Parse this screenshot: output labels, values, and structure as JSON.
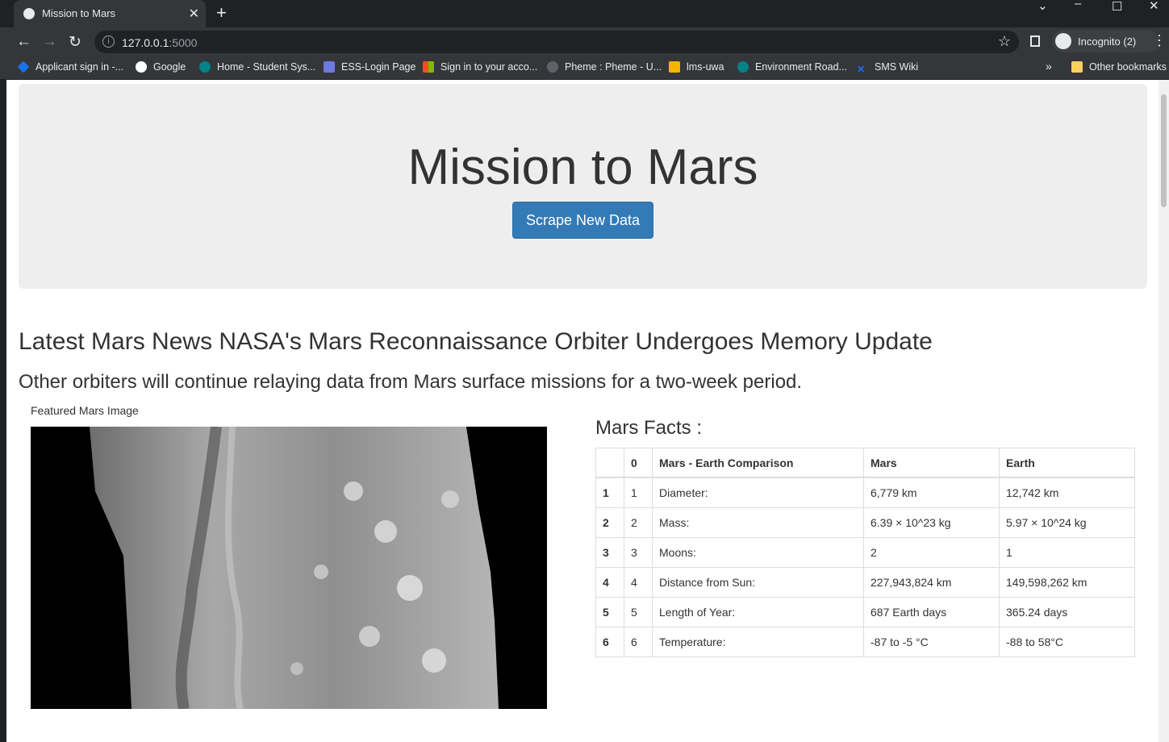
{
  "browser": {
    "tab_title": "Mission to Mars",
    "url_host": "127.0.0.1",
    "url_port": ":5000",
    "incognito_label": "Incognito (2)",
    "bookmarks": [
      {
        "label": "Applicant sign in -...",
        "icon": "diamond-icon",
        "color": "#1a73e8"
      },
      {
        "label": "Google",
        "icon": "google-icon",
        "color": "#ffffff"
      },
      {
        "label": "Home - Student Sys...",
        "icon": "sharepoint-icon",
        "color": "#038387"
      },
      {
        "label": "ESS-Login Page",
        "icon": "crest-icon",
        "color": "#6c7ae0"
      },
      {
        "label": "Sign in to your acco...",
        "icon": "microsoft-icon",
        "color": "#f25022"
      },
      {
        "label": "Pheme : Pheme - U...",
        "icon": "globe-icon",
        "color": "#5f6368"
      },
      {
        "label": "lms-uwa",
        "icon": "pencil-icon",
        "color": "#f4b400"
      },
      {
        "label": "Environment Road...",
        "icon": "sharepoint-icon",
        "color": "#038387"
      },
      {
        "label": "SMS Wiki",
        "icon": "x-icon",
        "color": "#1a73e8"
      }
    ],
    "other_bookmarks": "Other bookmarks",
    "overflow": "»"
  },
  "page": {
    "heading": "Mission to Mars",
    "scrape_button": "Scrape New Data",
    "news_title": "Latest Mars News NASA's Mars Reconnaissance Orbiter Undergoes Memory Update",
    "news_paragraph": "Other orbiters will continue relaying data from Mars surface missions for a two-week period.",
    "featured_image_label": "Featured Mars Image",
    "facts_title": "Mars Facts :",
    "facts_table": {
      "headers": [
        "",
        "0",
        "Mars - Earth Comparison",
        "Mars",
        "Earth"
      ],
      "rows": [
        [
          "1",
          "1",
          "Diameter:",
          "6,779 km",
          "12,742 km"
        ],
        [
          "2",
          "2",
          "Mass:",
          "6.39 × 10^23 kg",
          "5.97 × 10^24 kg"
        ],
        [
          "3",
          "3",
          "Moons:",
          "2",
          "1"
        ],
        [
          "4",
          "4",
          "Distance from Sun:",
          "227,943,824 km",
          "149,598,262 km"
        ],
        [
          "5",
          "5",
          "Length of Year:",
          "687 Earth days",
          "365.24 days"
        ],
        [
          "6",
          "6",
          "Temperature:",
          "-87 to -5 °C",
          "-88 to 58°C"
        ]
      ]
    }
  }
}
